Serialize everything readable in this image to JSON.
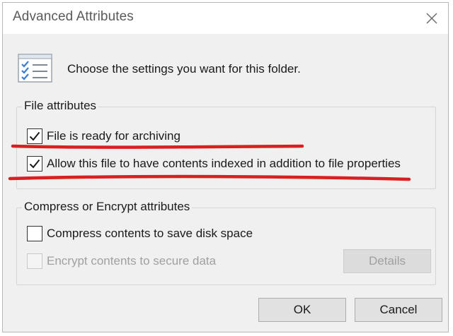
{
  "window": {
    "title": "Advanced Attributes",
    "close_icon": "close-icon"
  },
  "header": {
    "icon": "attributes-list-icon",
    "text": "Choose the settings you want for this folder."
  },
  "file_attributes": {
    "group_title": "File attributes",
    "options": [
      {
        "label": "File is ready for archiving",
        "checked": true,
        "enabled": true
      },
      {
        "label": "Allow this file to have contents indexed in addition to file properties",
        "checked": true,
        "enabled": true
      }
    ]
  },
  "compress_encrypt": {
    "group_title": "Compress or Encrypt attributes",
    "options": [
      {
        "label": "Compress contents to save disk space",
        "checked": false,
        "enabled": true
      },
      {
        "label": "Encrypt contents to secure data",
        "checked": false,
        "enabled": false
      }
    ],
    "details_button": {
      "label": "Details",
      "enabled": false
    }
  },
  "footer": {
    "ok_label": "OK",
    "cancel_label": "Cancel"
  },
  "annotation": {
    "color": "#d91f1f"
  }
}
